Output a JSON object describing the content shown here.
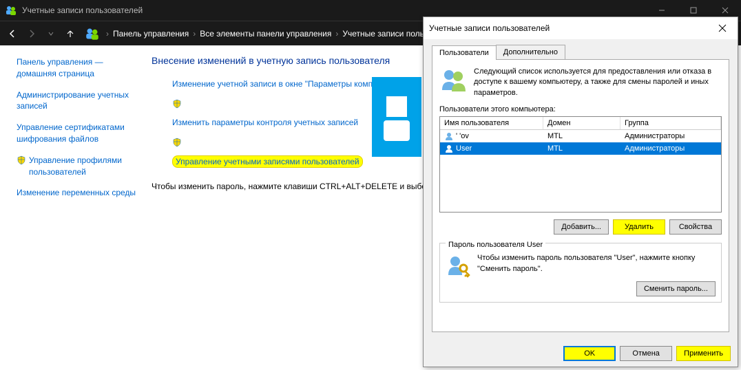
{
  "window": {
    "title": "Учетные записи пользователей",
    "breadcrumb": [
      "Панель управления",
      "Все элементы панели управления",
      "Учетные записи поль..."
    ]
  },
  "sidebar": {
    "items": [
      "Панель управления — домашняя страница",
      "Администрирование учетных записей",
      "Управление сертификатами шифрования файлов",
      "Управление профилями пользователей",
      "Изменение переменных среды"
    ]
  },
  "main": {
    "heading": "Внесение изменений в учетную запись пользователя",
    "actions": [
      "Изменение учетной записи в окне \"Параметры компьютера\"",
      "Изменить параметры контроля учетных записей",
      "Управление учетными записями пользователей"
    ],
    "info": "Чтобы изменить пароль, нажмите клавиши CTRL+ALT+DELETE и выбе"
  },
  "dialog": {
    "title": "Учетные записи пользователей",
    "tabs": [
      "Пользователи",
      "Дополнительно"
    ],
    "desc": "Следующий список используется для предоставления или отказа в доступе к вашему компьютеру, а также для смены паролей и иных параметров.",
    "list_label": "Пользователи этого компьютера:",
    "columns": [
      "Имя пользователя",
      "Домен",
      "Группа"
    ],
    "rows": [
      {
        "name": "   '  'ov",
        "domain": "MTL",
        "group": "Администраторы",
        "selected": false
      },
      {
        "name": "User",
        "domain": "MTL     ",
        "group": "Администраторы",
        "selected": true
      }
    ],
    "buttons": {
      "add": "Добавить...",
      "remove": "Удалить",
      "props": "Свойства"
    },
    "fieldset": {
      "legend": "Пароль пользователя User",
      "text": "Чтобы изменить пароль пользователя \"User\", нажмите кнопку \"Сменить пароль\".",
      "change": "Сменить пароль..."
    },
    "footer": {
      "ok": "OK",
      "cancel": "Отмена",
      "apply": "Применить"
    }
  }
}
